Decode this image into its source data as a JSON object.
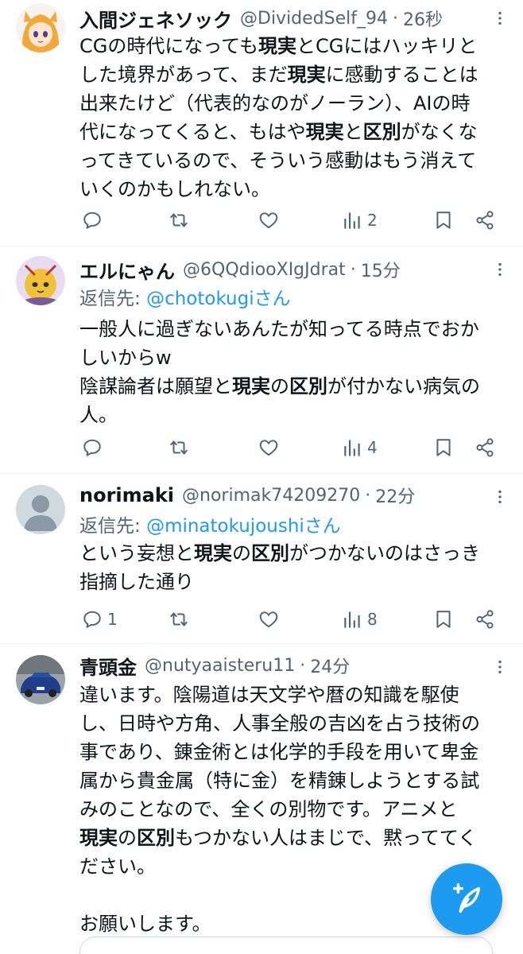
{
  "tweets": [
    {
      "name": "入間ジェネソック",
      "handle": "@DividedSelf_94",
      "separator": "·",
      "time": "26秒",
      "reply_prefix": "",
      "reply_mention": "",
      "reply_suffix": "",
      "body": [
        [
          {
            "t": "CGの時代になっても"
          },
          {
            "t": "現実",
            "b": true
          },
          {
            "t": "とCGにはハッキリと"
          }
        ],
        [
          {
            "t": "した境界があって、まだ"
          },
          {
            "t": "現実",
            "b": true
          },
          {
            "t": "に感動することは"
          }
        ],
        [
          {
            "t": "出来たけど（代表的なのがノーラン）、AIの時"
          }
        ],
        [
          {
            "t": "代になってくると、もはや"
          },
          {
            "t": "現実",
            "b": true
          },
          {
            "t": "と"
          },
          {
            "t": "区別",
            "b": true
          },
          {
            "t": "がなくな"
          }
        ],
        [
          {
            "t": "ってきているので、そういう感動はもう消えて"
          }
        ],
        [
          {
            "t": "いくのかもしれない。"
          }
        ]
      ],
      "counts": {
        "replies": "",
        "retweets": "",
        "likes": "",
        "views": "2"
      }
    },
    {
      "name": "エルにゃん",
      "handle": "@6QQdiooXIgJdrat",
      "separator": "·",
      "time": "15分",
      "reply_prefix": "返信先: ",
      "reply_mention": "@chotokugi",
      "reply_suffix": "さん",
      "body": [
        [
          {
            "t": "一般人に過ぎないあんたが知ってる時点でおか"
          }
        ],
        [
          {
            "t": "しいからw"
          }
        ],
        [
          {
            "t": "陰謀論者は願望と"
          },
          {
            "t": "現実",
            "b": true
          },
          {
            "t": "の"
          },
          {
            "t": "区別",
            "b": true
          },
          {
            "t": "が付かない病気の"
          }
        ],
        [
          {
            "t": "人。"
          }
        ]
      ],
      "counts": {
        "replies": "",
        "retweets": "",
        "likes": "",
        "views": "4"
      }
    },
    {
      "name": "norimaki",
      "handle": "@norimak74209270",
      "separator": "·",
      "time": "22分",
      "reply_prefix": "返信先: ",
      "reply_mention": "@minatokujoushi",
      "reply_suffix": "さん",
      "body": [
        [
          {
            "t": "という妄想と"
          },
          {
            "t": "現実",
            "b": true
          },
          {
            "t": "の"
          },
          {
            "t": "区別",
            "b": true
          },
          {
            "t": "がつかないのはさっき"
          }
        ],
        [
          {
            "t": "指摘した通り"
          }
        ]
      ],
      "counts": {
        "replies": "1",
        "retweets": "",
        "likes": "",
        "views": "8"
      }
    },
    {
      "name": "青頭金",
      "handle": "@nutyaaisteru11",
      "separator": "·",
      "time": "24分",
      "reply_prefix": "",
      "reply_mention": "",
      "reply_suffix": "",
      "body": [
        [
          {
            "t": "違います。陰陽道は天文学や暦の知識を駆使"
          }
        ],
        [
          {
            "t": "し、日時や方角、人事全般の吉凶を占う技術の"
          }
        ],
        [
          {
            "t": "事であり、錬金術とは化学的手段を用いて卑金"
          }
        ],
        [
          {
            "t": "属から貴金属（特に金）を精錬しようとする試"
          }
        ],
        [
          {
            "t": "みのことなので、全くの別物です。アニメと"
          }
        ],
        [
          {
            "t": "現実",
            "b": true
          },
          {
            "t": "の"
          },
          {
            "t": "区別",
            "b": true
          },
          {
            "t": "もつかない人はまじで、黙っててく"
          }
        ],
        [
          {
            "t": "ださい。"
          }
        ],
        [
          {
            "t": ""
          }
        ],
        [
          {
            "t": "お願いします。"
          }
        ]
      ],
      "counts": {
        "replies": "",
        "retweets": "",
        "likes": "",
        "views": ""
      }
    }
  ],
  "icons": {
    "reply": "speech-bubble-icon",
    "retweet": "retweet-arrows-icon",
    "like": "heart-icon",
    "views": "bar-chart-icon",
    "bookmark": "bookmark-icon",
    "share": "share-icon",
    "more": "more-dots-icon",
    "compose": "feather-plus-icon"
  },
  "colors": {
    "accent": "#1d9bf0",
    "text": "#0f1419",
    "muted": "#536471",
    "divider": "#eff3f4"
  }
}
